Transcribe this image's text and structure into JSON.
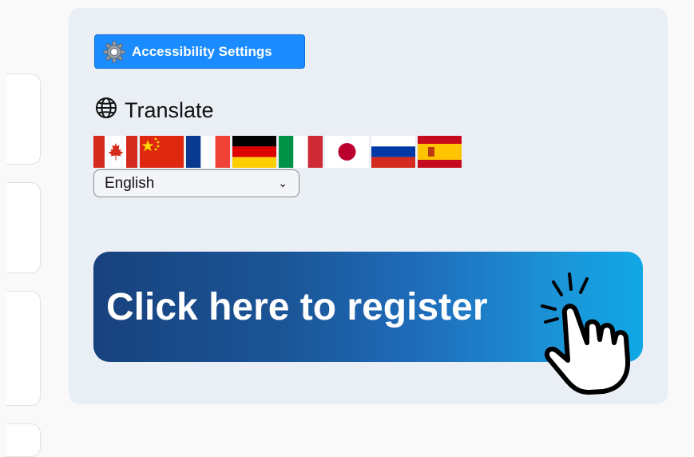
{
  "accessibility": {
    "label": "Accessibility Settings",
    "icon": "gear-icon"
  },
  "translate": {
    "heading": "Translate",
    "icon": "globe-icon",
    "flags": [
      {
        "name": "canada-flag"
      },
      {
        "name": "china-flag"
      },
      {
        "name": "france-flag"
      },
      {
        "name": "germany-flag"
      },
      {
        "name": "italy-flag"
      },
      {
        "name": "japan-flag"
      },
      {
        "name": "russia-flag"
      },
      {
        "name": "spain-flag"
      }
    ],
    "selected_language": "English"
  },
  "register_banner": {
    "label": "Click here to register",
    "icon": "pointing-hand-icon"
  },
  "colors": {
    "accent": "#1a8cff",
    "panel_bg": "#eaeef5",
    "banner_start": "#18427e",
    "banner_end": "#10a7e6"
  }
}
